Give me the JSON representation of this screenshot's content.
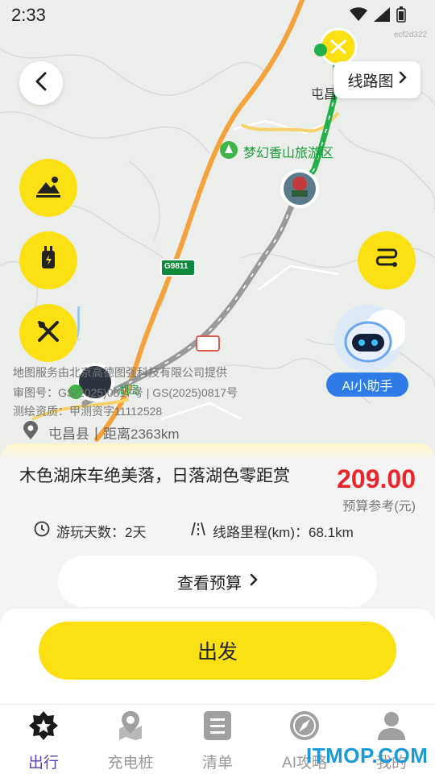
{
  "status": {
    "time": "2:33"
  },
  "map": {
    "watermark_id": "ecf2d322",
    "route_button_label": "线路图",
    "scenic_label": "梦幻香山旅游区",
    "town_label": "屯昌",
    "road_shield": "G9811",
    "poi_label": "湖岛",
    "credits": [
      "地图服务由北京高德图强科技有限公司提供",
      "审图号：GS(2025)0817号 | GS(2025)0817号",
      "测绘资质：甲测资字11112528"
    ],
    "location_text": "屯昌县丨距离2363km",
    "ai_label": "AI小助手",
    "colors": {
      "route_green": "#22b04a",
      "route_gray": "#9a9a9a",
      "highway_orange": "#f5a23c",
      "accent_yellow": "#fbe114"
    }
  },
  "side_buttons": [
    "scenery-icon",
    "charger-icon",
    "food-icon"
  ],
  "trip": {
    "title": "木色湖床车绝美落，日落湖色零距赏",
    "price": "209.00",
    "price_label": "预算参考(元)",
    "days_text": "游玩天数：2天",
    "distance_text": "线路里程(km)：68.1km",
    "budget_button": "查看预算",
    "go_button": "出发"
  },
  "tabs": [
    {
      "label": "出行",
      "icon": "travel-icon",
      "active": true
    },
    {
      "label": "充电桩",
      "icon": "charger-map-icon",
      "active": false
    },
    {
      "label": "清单",
      "icon": "list-icon",
      "active": false
    },
    {
      "label": "AI攻略",
      "icon": "compass-icon",
      "active": false
    },
    {
      "label": "我的",
      "icon": "profile-icon",
      "active": false
    }
  ],
  "brand_watermark": "ITMOP.COM"
}
